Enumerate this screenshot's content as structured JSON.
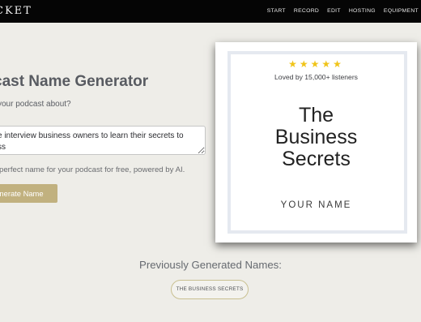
{
  "header": {
    "logo": "CKET",
    "nav": [
      "START",
      "RECORD",
      "EDIT",
      "HOSTING",
      "EQUIPMENT"
    ]
  },
  "form": {
    "title": "cast Name Generator",
    "question": "your podcast about?",
    "textarea_value": "e interview business owners to learn their secrets to\nss",
    "helper": "e perfect name for your podcast for free, powered by AI.",
    "button_label": "nerate Name"
  },
  "cover": {
    "stars": "★★★★★",
    "rating_count": "Loved by 15,000+ listeners",
    "title_line1": "The",
    "title_line2": "Business",
    "title_line3": "Secrets",
    "author": "YOUR NAME"
  },
  "previous": {
    "heading": "Previously Generated Names:",
    "names": [
      "THE BUSINESS SECRETS"
    ]
  },
  "colors": {
    "background": "#eeede8",
    "topbar": "#050505",
    "accent": "#c1b17f",
    "star": "#f0c419"
  }
}
